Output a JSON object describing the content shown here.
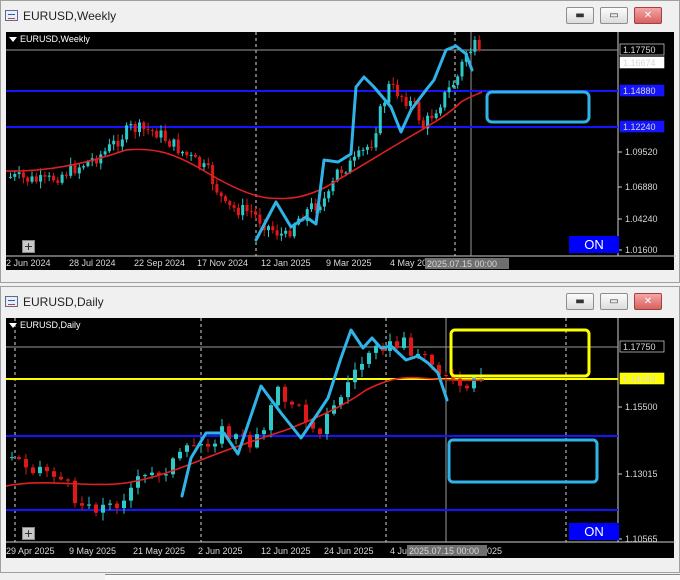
{
  "weekly_window": {
    "title": "EURUSD,Weekly",
    "chart_label": "EURUSD,Weekly",
    "price_ticks": [
      "1.17750",
      "1.16674",
      "1.14880",
      "1.12240",
      "1.09520",
      "1.06880",
      "1.04240",
      "1.01600"
    ],
    "date_ticks": [
      "2 Jun 2024",
      "28 Jul 2024",
      "22 Sep 2024",
      "17 Nov 2024",
      "12 Jan 2025",
      "9 Mar 2025",
      "4 May 20"
    ],
    "crosshair_time": "2025.07.15 00:00",
    "on_label": "ON",
    "cross_glyph": "+"
  },
  "daily_window": {
    "title": "EURUSD,Daily",
    "chart_label": "EURUSD,Daily",
    "price_ticks": [
      "1.17750",
      "1.16493",
      "1.15500",
      "1.13015",
      "1.10565"
    ],
    "date_ticks": [
      "29 Apr 2025",
      "9 May 2025",
      "21 May 2025",
      "2 Jun 2025",
      "12 Jun 2025",
      "24 Jun 2025",
      "4 Ju",
      "2025"
    ],
    "crosshair_time": "2025.07.15 00:00",
    "on_label": "ON",
    "cross_glyph": "+"
  },
  "window_buttons": {
    "minimize": "▬",
    "maximize": "▭",
    "close": "✕"
  },
  "icons": {
    "app": "chart-window-icon",
    "minimize": "minimize-icon",
    "maximize": "maximize-icon",
    "close": "close-icon"
  },
  "colors": {
    "chart_bg": "#000000",
    "bull_candle": "#2fc9c9",
    "bear_candle": "#e01818",
    "moving_average": "#e02020",
    "support_line": "#1414ff",
    "price_line_daily": "#ffff00",
    "drawn_path": "#2fb4e8",
    "highlight_box_yellow": "#ffff00",
    "highlight_box_blue": "#2fb4e8",
    "on_button": "#0000ff"
  }
}
